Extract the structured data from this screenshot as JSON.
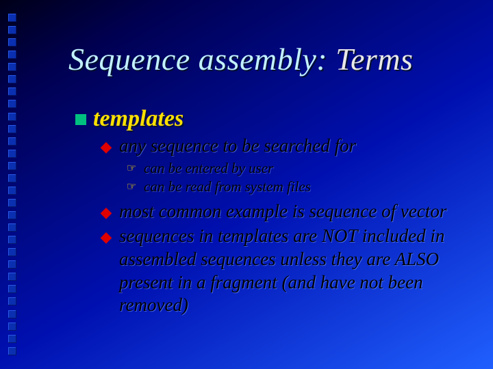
{
  "title": {
    "part1": "Sequence assembly:",
    "part2": " Terms"
  },
  "bullets": {
    "l1": "templates",
    "l2a": "any sequence to be searched for",
    "l3a": "can be entered by user",
    "l3b": "can be read from system files",
    "l2b": "most common example is sequence of vector",
    "l2c": "sequences in templates are NOT included in assembled sequences unless they are ALSO present in a fragment (and have not been removed)"
  }
}
